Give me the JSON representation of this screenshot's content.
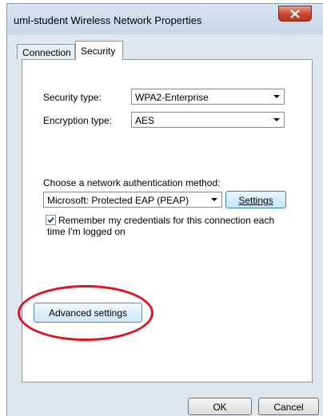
{
  "window": {
    "title": "uml-student Wireless Network Properties"
  },
  "tabs": [
    {
      "label": "Connection",
      "active": false
    },
    {
      "label": "Security",
      "active": true
    }
  ],
  "security": {
    "security_type_label": "Security type:",
    "security_type_value": "WPA2-Enterprise",
    "encryption_type_label": "Encryption type:",
    "encryption_type_value": "AES",
    "auth_method_label": "Choose a network authentication method:",
    "auth_method_value": "Microsoft: Protected EAP (PEAP)",
    "settings_button": "Settings",
    "remember_checked": true,
    "remember_label_line1": "Remember my credentials for this connection each",
    "remember_label_line2": "time I'm logged on",
    "advanced_button": "Advanced settings"
  },
  "footer": {
    "ok_button": "OK",
    "cancel_button": "Cancel"
  },
  "colors": {
    "highlight_circle": "#e0141e",
    "close_button": "#c6452f"
  }
}
